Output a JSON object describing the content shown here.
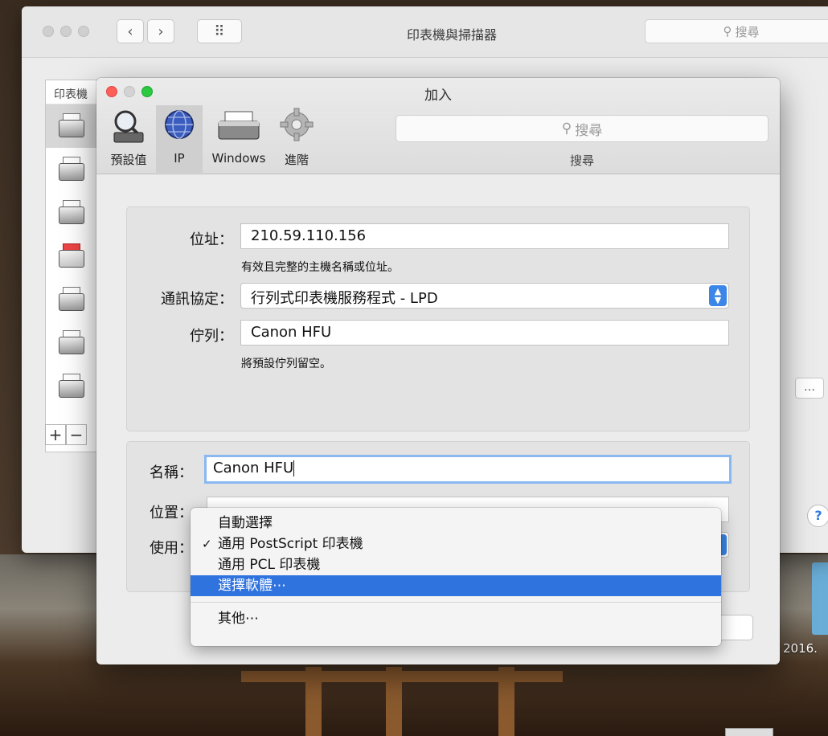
{
  "main_window": {
    "title": "印表機與掃描器",
    "search_placeholder": "搜尋",
    "nav_back": "‹",
    "nav_forward": "›",
    "grid_icon": "⠿",
    "printer_list_header": "印表機",
    "add_label": "+",
    "remove_label": "−",
    "more_label": "…",
    "help_label": "?"
  },
  "dialog": {
    "title": "加入",
    "toolbar": {
      "default_label": "預設值",
      "ip_label": "IP",
      "windows_label": "Windows",
      "advanced_label": "進階",
      "search_placeholder": "搜尋",
      "search_label": "搜尋"
    },
    "address": {
      "label": "位址：",
      "value": "210.59.110.156",
      "hint": "有效且完整的主機名稱或位址。"
    },
    "protocol": {
      "label": "通訊協定：",
      "value": "行列式印表機服務程式 - LPD"
    },
    "queue": {
      "label": "佇列：",
      "value": "Canon HFU",
      "hint": "將預設佇列留空。"
    },
    "name": {
      "label": "名稱：",
      "value": "Canon HFU"
    },
    "location": {
      "label": "位置：",
      "value": ""
    },
    "use": {
      "label": "使用："
    }
  },
  "menu": {
    "items": [
      {
        "label": "自動選擇",
        "checked": false
      },
      {
        "label": "通用 PostScript 印表機",
        "checked": true
      },
      {
        "label": "通用 PCL 印表機",
        "checked": false
      },
      {
        "label": "選擇軟體⋯",
        "checked": false,
        "highlighted": true
      }
    ],
    "other_label": "其他⋯",
    "check_mark": "✓"
  },
  "desktop": {
    "date_label": "2016."
  },
  "colors": {
    "accent": "#2f73de",
    "close": "#fc5f57",
    "minimize": "#d3d3d3",
    "zoom": "#2bc840"
  }
}
